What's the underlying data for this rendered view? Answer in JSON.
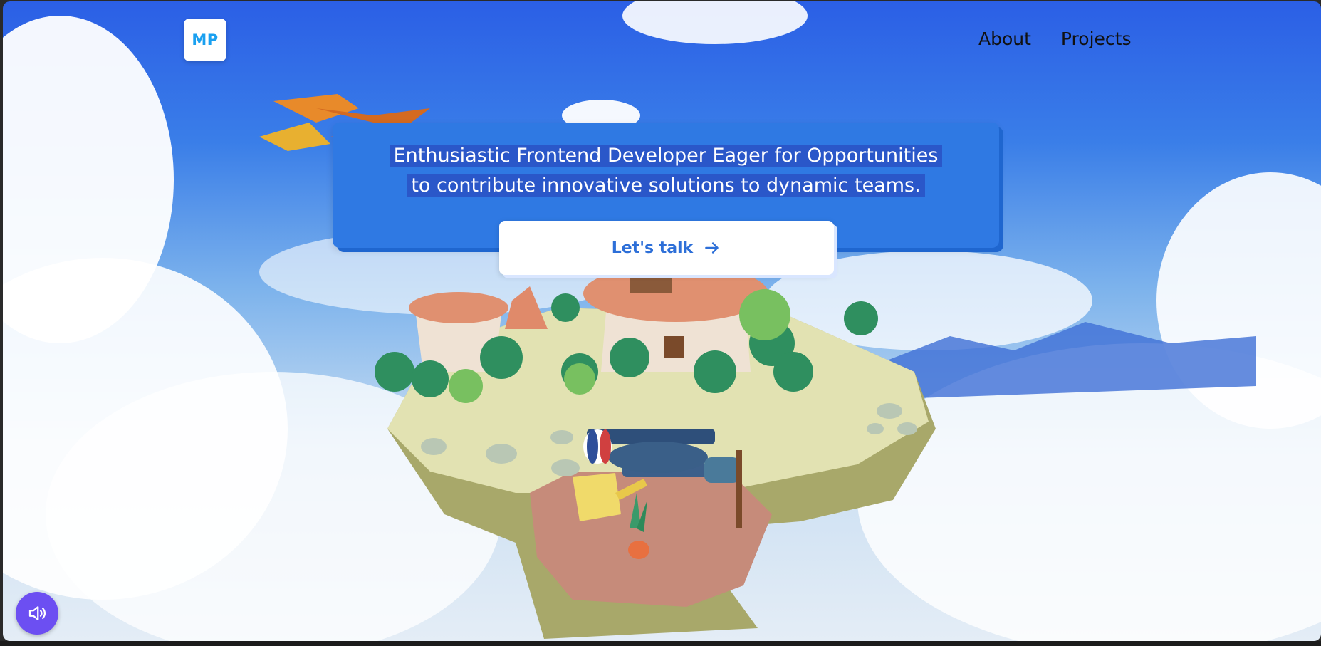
{
  "header": {
    "logo_text": "MP",
    "nav": [
      {
        "label": "About"
      },
      {
        "label": "Projects"
      }
    ]
  },
  "hero": {
    "line1": "Enthusiastic Frontend Developer Eager for Opportunities",
    "line2": "to contribute innovative solutions to dynamic teams.",
    "cta_label": "Let's talk",
    "cta_icon": "arrow-right-icon"
  },
  "controls": {
    "sound_icon": "speaker-icon"
  },
  "scene": {
    "description_icons": [
      "floating-island",
      "biplane",
      "phoenix-bird",
      "clouds"
    ]
  }
}
